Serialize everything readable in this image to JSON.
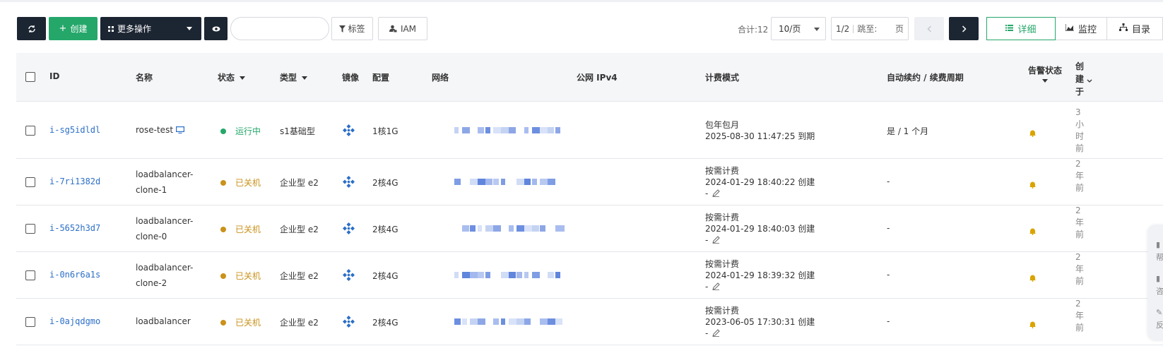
{
  "toolbar": {
    "refresh_icon": "refresh-icon",
    "create_label": "创建",
    "more_actions_label": "更多操作",
    "eye_icon": "eye-icon",
    "search_placeholder": "",
    "tag_label": "标签",
    "iam_label": "IAM"
  },
  "pagination": {
    "total_label": "合计:12",
    "page_size": "10/页",
    "page_indicator": "1/2",
    "jump_label": "跳至:",
    "page_unit": "页"
  },
  "view_switch": {
    "detail_label": "详细",
    "monitor_label": "监控",
    "catalog_label": "目录",
    "active": "detail"
  },
  "colors": {
    "accent_green": "#25a76a",
    "link_blue": "#2b6fc7",
    "running_green": "#25a76a",
    "stopped_orange": "#c9921b",
    "dark": "#1c2532"
  },
  "table": {
    "headers": {
      "id": "ID",
      "name": "名称",
      "status": "状态",
      "type": "类型",
      "image": "镜像",
      "config": "配置",
      "network": "网络",
      "public_ipv4": "公网 IPv4",
      "billing": "计费模式",
      "renew": "自动续约 / 续费周期",
      "alert": "告警状态",
      "created": "创建于"
    },
    "rows": [
      {
        "id": "i-sg5idldl",
        "name_line1": "rose-test",
        "name_line2": "",
        "status": "运行中",
        "status_kind": "running",
        "type": "s1基础型",
        "config": "1核1G",
        "billing_line1": "包年包月",
        "billing_line2": "2025-08-30 11:47:25 到期",
        "billing_line3": "",
        "renew": "是 / 1 个月",
        "created": "3小时前"
      },
      {
        "id": "i-7ri1382d",
        "name_line1": "loadbalancer-",
        "name_line2": "clone-1",
        "status": "已关机",
        "status_kind": "stopped",
        "type": "企业型 e2",
        "config": "2核4G",
        "billing_line1": "按需计费",
        "billing_line2": "2024-01-29 18:40:22 创建",
        "billing_line3": "-",
        "renew": "-",
        "created": "2年前"
      },
      {
        "id": "i-5652h3d7",
        "name_line1": "loadbalancer-",
        "name_line2": "clone-0",
        "status": "已关机",
        "status_kind": "stopped",
        "type": "企业型 e2",
        "config": "2核4G",
        "billing_line1": "按需计费",
        "billing_line2": "2024-01-29 18:40:03 创建",
        "billing_line3": "-",
        "renew": "-",
        "created": "2年前"
      },
      {
        "id": "i-0n6r6a1s",
        "name_line1": "loadbalancer-",
        "name_line2": "clone-2",
        "status": "已关机",
        "status_kind": "stopped",
        "type": "企业型 e2",
        "config": "2核4G",
        "billing_line1": "按需计费",
        "billing_line2": "2024-01-29 18:39:32 创建",
        "billing_line3": "-",
        "renew": "-",
        "created": "2年前"
      },
      {
        "id": "i-0ajqdgmo",
        "name_line1": "loadbalancer",
        "name_line2": "",
        "status": "已关机",
        "status_kind": "stopped",
        "type": "企业型 e2",
        "config": "2核4G",
        "billing_line1": "按需计费",
        "billing_line2": "2023-06-05 17:30:31 创建",
        "billing_line3": "-",
        "renew": "-",
        "created": "2年前"
      }
    ]
  },
  "side_widget": {
    "items": [
      "帮",
      "咨",
      "反"
    ]
  }
}
